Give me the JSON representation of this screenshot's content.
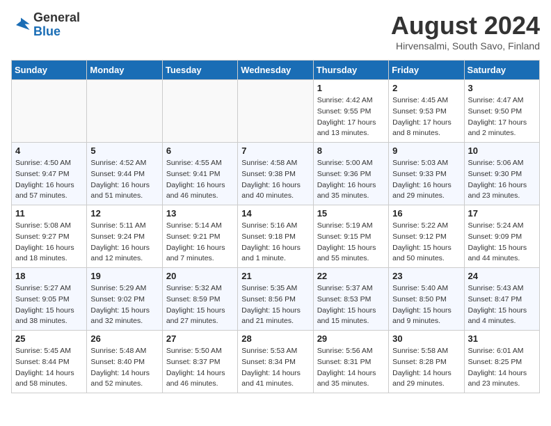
{
  "header": {
    "logo_line1": "General",
    "logo_line2": "Blue",
    "month_title": "August 2024",
    "subtitle": "Hirvensalmi, South Savo, Finland"
  },
  "weekdays": [
    "Sunday",
    "Monday",
    "Tuesday",
    "Wednesday",
    "Thursday",
    "Friday",
    "Saturday"
  ],
  "weeks": [
    [
      {
        "day": "",
        "info": ""
      },
      {
        "day": "",
        "info": ""
      },
      {
        "day": "",
        "info": ""
      },
      {
        "day": "",
        "info": ""
      },
      {
        "day": "1",
        "info": "Sunrise: 4:42 AM\nSunset: 9:55 PM\nDaylight: 17 hours\nand 13 minutes."
      },
      {
        "day": "2",
        "info": "Sunrise: 4:45 AM\nSunset: 9:53 PM\nDaylight: 17 hours\nand 8 minutes."
      },
      {
        "day": "3",
        "info": "Sunrise: 4:47 AM\nSunset: 9:50 PM\nDaylight: 17 hours\nand 2 minutes."
      }
    ],
    [
      {
        "day": "4",
        "info": "Sunrise: 4:50 AM\nSunset: 9:47 PM\nDaylight: 16 hours\nand 57 minutes."
      },
      {
        "day": "5",
        "info": "Sunrise: 4:52 AM\nSunset: 9:44 PM\nDaylight: 16 hours\nand 51 minutes."
      },
      {
        "day": "6",
        "info": "Sunrise: 4:55 AM\nSunset: 9:41 PM\nDaylight: 16 hours\nand 46 minutes."
      },
      {
        "day": "7",
        "info": "Sunrise: 4:58 AM\nSunset: 9:38 PM\nDaylight: 16 hours\nand 40 minutes."
      },
      {
        "day": "8",
        "info": "Sunrise: 5:00 AM\nSunset: 9:36 PM\nDaylight: 16 hours\nand 35 minutes."
      },
      {
        "day": "9",
        "info": "Sunrise: 5:03 AM\nSunset: 9:33 PM\nDaylight: 16 hours\nand 29 minutes."
      },
      {
        "day": "10",
        "info": "Sunrise: 5:06 AM\nSunset: 9:30 PM\nDaylight: 16 hours\nand 23 minutes."
      }
    ],
    [
      {
        "day": "11",
        "info": "Sunrise: 5:08 AM\nSunset: 9:27 PM\nDaylight: 16 hours\nand 18 minutes."
      },
      {
        "day": "12",
        "info": "Sunrise: 5:11 AM\nSunset: 9:24 PM\nDaylight: 16 hours\nand 12 minutes."
      },
      {
        "day": "13",
        "info": "Sunrise: 5:14 AM\nSunset: 9:21 PM\nDaylight: 16 hours\nand 7 minutes."
      },
      {
        "day": "14",
        "info": "Sunrise: 5:16 AM\nSunset: 9:18 PM\nDaylight: 16 hours\nand 1 minute."
      },
      {
        "day": "15",
        "info": "Sunrise: 5:19 AM\nSunset: 9:15 PM\nDaylight: 15 hours\nand 55 minutes."
      },
      {
        "day": "16",
        "info": "Sunrise: 5:22 AM\nSunset: 9:12 PM\nDaylight: 15 hours\nand 50 minutes."
      },
      {
        "day": "17",
        "info": "Sunrise: 5:24 AM\nSunset: 9:09 PM\nDaylight: 15 hours\nand 44 minutes."
      }
    ],
    [
      {
        "day": "18",
        "info": "Sunrise: 5:27 AM\nSunset: 9:05 PM\nDaylight: 15 hours\nand 38 minutes."
      },
      {
        "day": "19",
        "info": "Sunrise: 5:29 AM\nSunset: 9:02 PM\nDaylight: 15 hours\nand 32 minutes."
      },
      {
        "day": "20",
        "info": "Sunrise: 5:32 AM\nSunset: 8:59 PM\nDaylight: 15 hours\nand 27 minutes."
      },
      {
        "day": "21",
        "info": "Sunrise: 5:35 AM\nSunset: 8:56 PM\nDaylight: 15 hours\nand 21 minutes."
      },
      {
        "day": "22",
        "info": "Sunrise: 5:37 AM\nSunset: 8:53 PM\nDaylight: 15 hours\nand 15 minutes."
      },
      {
        "day": "23",
        "info": "Sunrise: 5:40 AM\nSunset: 8:50 PM\nDaylight: 15 hours\nand 9 minutes."
      },
      {
        "day": "24",
        "info": "Sunrise: 5:43 AM\nSunset: 8:47 PM\nDaylight: 15 hours\nand 4 minutes."
      }
    ],
    [
      {
        "day": "25",
        "info": "Sunrise: 5:45 AM\nSunset: 8:44 PM\nDaylight: 14 hours\nand 58 minutes."
      },
      {
        "day": "26",
        "info": "Sunrise: 5:48 AM\nSunset: 8:40 PM\nDaylight: 14 hours\nand 52 minutes."
      },
      {
        "day": "27",
        "info": "Sunrise: 5:50 AM\nSunset: 8:37 PM\nDaylight: 14 hours\nand 46 minutes."
      },
      {
        "day": "28",
        "info": "Sunrise: 5:53 AM\nSunset: 8:34 PM\nDaylight: 14 hours\nand 41 minutes."
      },
      {
        "day": "29",
        "info": "Sunrise: 5:56 AM\nSunset: 8:31 PM\nDaylight: 14 hours\nand 35 minutes."
      },
      {
        "day": "30",
        "info": "Sunrise: 5:58 AM\nSunset: 8:28 PM\nDaylight: 14 hours\nand 29 minutes."
      },
      {
        "day": "31",
        "info": "Sunrise: 6:01 AM\nSunset: 8:25 PM\nDaylight: 14 hours\nand 23 minutes."
      }
    ]
  ]
}
